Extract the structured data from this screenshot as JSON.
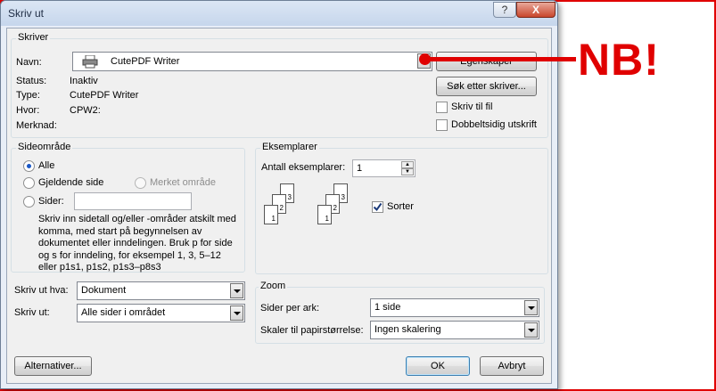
{
  "window": {
    "title": "Skriv ut",
    "help_label": "?",
    "close_label": "X"
  },
  "printer": {
    "group_title": "Skriver",
    "name_label": "Navn:",
    "name_value": "CutePDF Writer",
    "status_label": "Status:",
    "status_value": "Inaktiv",
    "type_label": "Type:",
    "type_value": "CutePDF Writer",
    "where_label": "Hvor:",
    "where_value": "CPW2:",
    "comment_label": "Merknad:",
    "comment_value": "",
    "properties_button": "Egenskaper",
    "find_printer_button": "Søk etter skriver...",
    "print_to_file_label": "Skriv til fil",
    "print_to_file_checked": false,
    "duplex_label": "Dobbeltsidig utskrift",
    "duplex_checked": false
  },
  "page_range": {
    "group_title": "Sideområde",
    "all_label": "Alle",
    "all_selected": true,
    "current_page_label": "Gjeldende side",
    "selection_label": "Merket område",
    "pages_label": "Sider:",
    "pages_value": "",
    "help_text": "Skriv inn sidetall og/eller -områder atskilt med komma, med start på begynnelsen av dokumentet eller inndelingen. Bruk p for side og s for inndeling, for eksempel 1, 3, 5–12 eller p1s1, p1s2, p1s3–p8s3"
  },
  "copies": {
    "group_title": "Eksemplarer",
    "count_label": "Antall eksemplarer:",
    "count_value": "1",
    "collate_label": "Sorter",
    "collate_checked": true,
    "page_numbers": [
      "3",
      "2",
      "1"
    ]
  },
  "print_what": {
    "label": "Skriv ut hva:",
    "value": "Dokument"
  },
  "print": {
    "label": "Skriv ut:",
    "value": "Alle sider i området"
  },
  "zoom": {
    "group_title": "Zoom",
    "pages_per_sheet_label": "Sider per ark:",
    "pages_per_sheet_value": "1 side",
    "scale_label": "Skaler til papirstørrelse:",
    "scale_value": "Ingen skalering"
  },
  "buttons": {
    "options": "Alternativer...",
    "ok": "OK",
    "cancel": "Avbryt"
  },
  "annotation": {
    "text": "NB!",
    "color": "#e00000"
  }
}
